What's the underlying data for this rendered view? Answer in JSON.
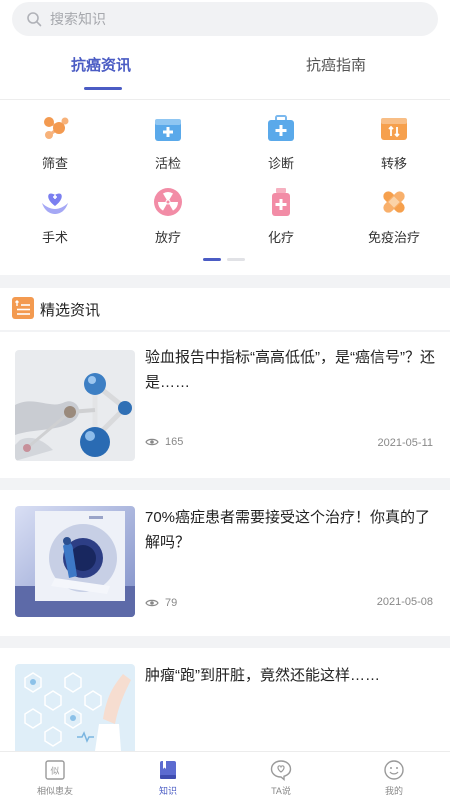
{
  "search": {
    "placeholder": "搜索知识"
  },
  "tabs": [
    {
      "label": "抗癌资讯",
      "active": true
    },
    {
      "label": "抗癌指南",
      "active": false
    }
  ],
  "categories": [
    {
      "label": "筛查",
      "icon": "molecule-icon",
      "color": "#f39a50"
    },
    {
      "label": "活检",
      "icon": "medical-kit-icon",
      "color": "#5aa9ea"
    },
    {
      "label": "诊断",
      "icon": "first-aid-box-icon",
      "color": "#5aa9ea"
    },
    {
      "label": "转移",
      "icon": "transfer-box-icon",
      "color": "#f6a04d"
    },
    {
      "label": "手术",
      "icon": "hands-heart-icon",
      "color": "#7b7ff0"
    },
    {
      "label": "放疗",
      "icon": "radiation-icon",
      "color": "#f28ca6"
    },
    {
      "label": "化疗",
      "icon": "medicine-bottle-icon",
      "color": "#f28ca6"
    },
    {
      "label": "免疫治疗",
      "icon": "bandage-icon",
      "color": "#f6a04d"
    }
  ],
  "section": {
    "title": "精选资讯"
  },
  "articles": [
    {
      "title": "验血报告中指标“高高低低”，是“癌信号”？还是……",
      "views": "165",
      "date": "2021-05-11",
      "image": "molecule-model-image"
    },
    {
      "title": "70%癌症患者需要接受这个治疗！你真的了解吗？",
      "views": "79",
      "date": "2021-05-08",
      "image": "radiotherapy-machine-image"
    },
    {
      "title": "肿瘤“跑”到肝脏，竟然还能这样……",
      "image": "medical-hexagon-image"
    }
  ],
  "bottom_nav": [
    {
      "label": "相似患友",
      "icon": "similar-patients-icon",
      "active": false
    },
    {
      "label": "知识",
      "icon": "book-icon",
      "active": true
    },
    {
      "label": "TA说",
      "icon": "chat-heart-icon",
      "active": false
    },
    {
      "label": "我的",
      "icon": "smile-face-icon",
      "active": false
    }
  ],
  "colors": {
    "accent": "#4b5cc4",
    "background": "#f2f3f5"
  }
}
